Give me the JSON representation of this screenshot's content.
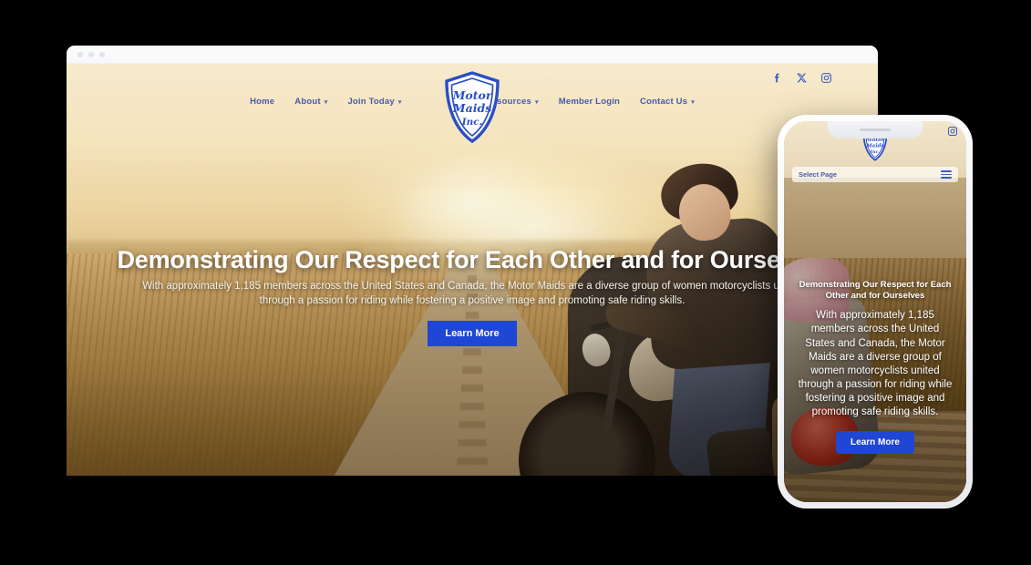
{
  "browser": {
    "traffic_dots": [
      "dot-1",
      "dot-2",
      "dot-3"
    ]
  },
  "desktop": {
    "logo": {
      "name": "motor-maids-shield-logo",
      "line1": "Motor",
      "line2": "Maids",
      "line3": "Inc.",
      "color": "#2b4fc4"
    },
    "socials": [
      {
        "icon": "facebook-icon",
        "label": "Facebook"
      },
      {
        "icon": "x-twitter-icon",
        "label": "X"
      },
      {
        "icon": "instagram-icon",
        "label": "Instagram"
      }
    ],
    "nav_left": [
      {
        "label": "Home",
        "has_caret": false
      },
      {
        "label": "About",
        "has_caret": true
      },
      {
        "label": "Join Today",
        "has_caret": true
      }
    ],
    "nav_right": [
      {
        "label": "Resources",
        "has_caret": true
      },
      {
        "label": "Member Login",
        "has_caret": false
      },
      {
        "label": "Contact Us",
        "has_caret": true
      }
    ],
    "hero": {
      "title": "Demonstrating Our Respect for Each Other and for Ourselves",
      "subtitle": "With approximately 1,185 members across the United States and Canada, the Motor Maids are a diverse group of women motorcyclists united through a passion for riding while fostering a positive image and promoting safe riding skills.",
      "cta_label": "Learn More",
      "cta_color": "#1f46d4"
    }
  },
  "mobile": {
    "logo": {
      "name": "motor-maids-shield-logo",
      "color": "#2b4fc4"
    },
    "social": {
      "icon": "instagram-icon",
      "label": "Instagram"
    },
    "select_page": {
      "label": "Select Page",
      "menu_icon": "hamburger-menu-icon"
    },
    "hero": {
      "title": "Demonstrating Our Respect for Each Other and for Ourselves",
      "subtitle": "With approximately 1,185 members across the United States and Canada, the Motor Maids are a diverse group of women motorcyclists united through a passion for riding while fostering a positive image and promoting safe riding skills.",
      "cta_label": "Learn More",
      "cta_color": "#1f46d4"
    }
  }
}
